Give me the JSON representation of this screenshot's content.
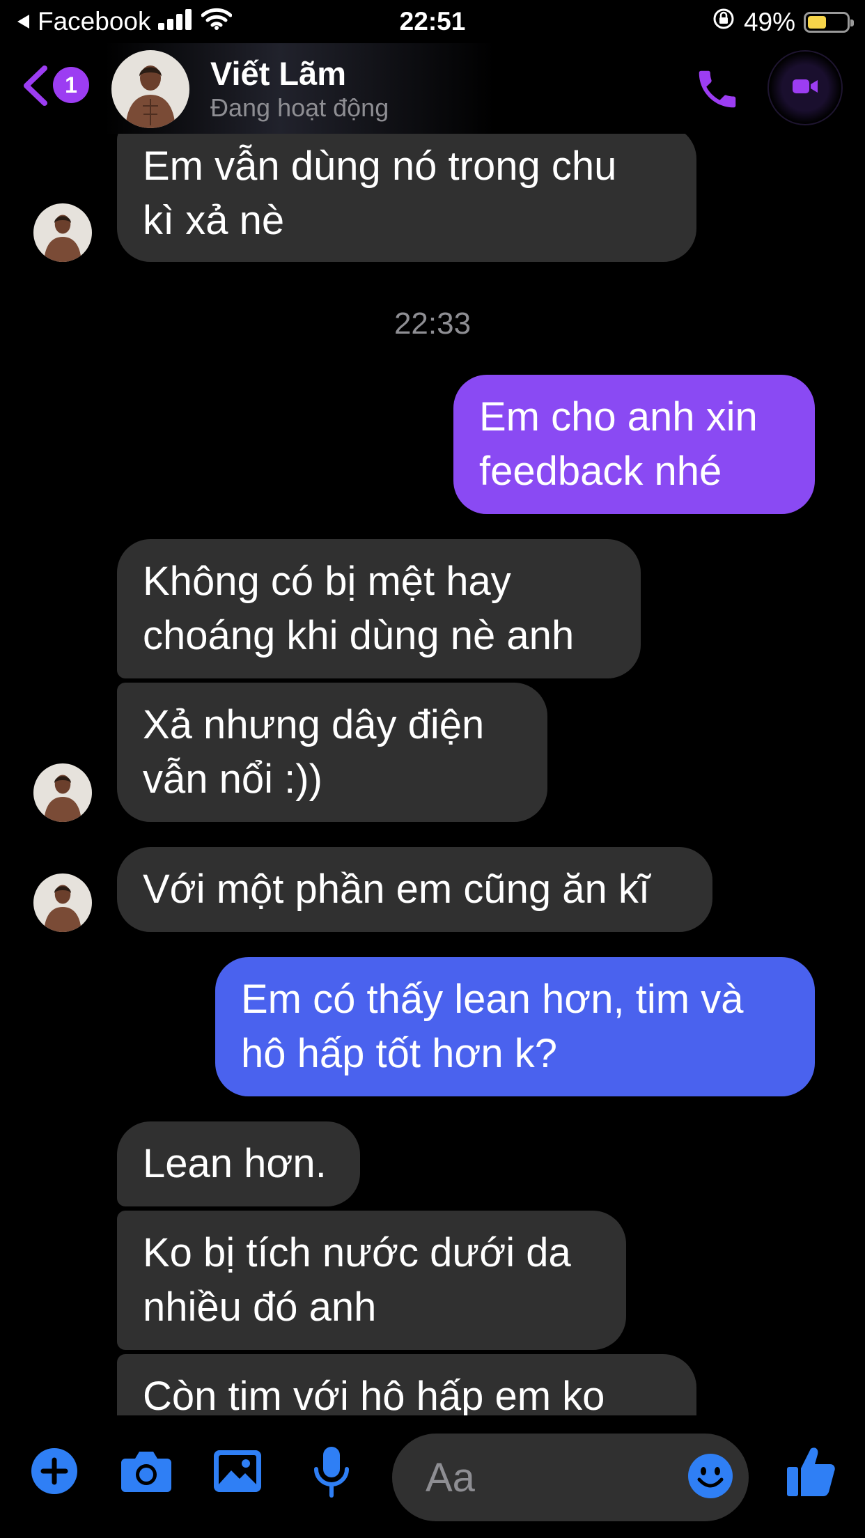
{
  "status_bar": {
    "back_app": "Facebook",
    "time": "22:51",
    "battery_percent": "49%",
    "battery_level": 0.49,
    "icons": [
      "signal-icon",
      "wifi-icon",
      "orientation-lock-icon",
      "battery-icon"
    ]
  },
  "header": {
    "badge_count": "1",
    "contact_name": "Viết Lãm",
    "contact_status": "Đang hoạt động",
    "accent_color": "#9c3df2"
  },
  "timestamp": "22:33",
  "messages": [
    {
      "from": "them",
      "text_lines": [
        "Em vẫn dùng nó trong chu",
        "kì xả nè"
      ]
    },
    {
      "from": "me",
      "text_lines": [
        "Em cho anh xin",
        "feedback nhé"
      ],
      "color": "#8a4af3"
    },
    {
      "from": "them",
      "text_lines": [
        "Không có bị mệt hay",
        "choáng khi dùng nè anh"
      ]
    },
    {
      "from": "them",
      "text_lines": [
        "Xả nhưng dây điện",
        "vẫn nổi :))"
      ]
    },
    {
      "from": "them",
      "text_lines": [
        "Với một phần em cũng ăn kĩ"
      ]
    },
    {
      "from": "me",
      "text_lines": [
        "Em có thấy lean hơn, tim và",
        "hô hấp tốt hơn k?"
      ],
      "color": "#4a62ee"
    },
    {
      "from": "them",
      "text_lines": [
        "Lean hơn."
      ]
    },
    {
      "from": "them",
      "text_lines": [
        "Ko bị tích nước dưới da",
        "nhiều đó anh"
      ]
    },
    {
      "from": "them",
      "text_lines": [
        "Còn tim với hô hấp em ko"
      ]
    }
  ],
  "composer": {
    "placeholder": "Aa",
    "icon_color": "#2f7ff5",
    "icons": [
      "plus-icon",
      "camera-icon",
      "gallery-icon",
      "microphone-icon",
      "emoji-icon",
      "like-icon"
    ]
  }
}
